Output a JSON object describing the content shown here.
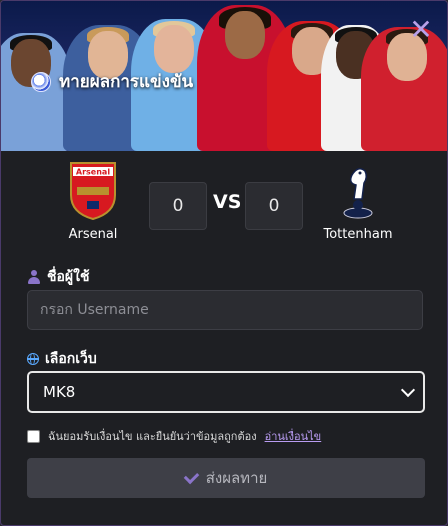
{
  "modal": {
    "title": "ทายผลการแข่งขัน",
    "close_glyph": "✕"
  },
  "match": {
    "home": {
      "name": "Arsenal",
      "score": "0",
      "logo_text": "Arsenal"
    },
    "vs_label": "VS",
    "away": {
      "name": "Tottenham",
      "score": "0"
    }
  },
  "form": {
    "username_label": "ชื่อผู้ใช้",
    "username_placeholder": "กรอก Username",
    "web_label": "เลือกเว็บ",
    "web_selected": "MK8",
    "agree_text": "ฉันยอมรับเงื่อนไข และยืนยันว่าข้อมูลถูกต้อง",
    "agree_link": "อ่านเงื่อนไข",
    "submit_label": "ส่งผลทาย"
  },
  "colors": {
    "accent": "#8a74c9",
    "link": "#b99cf2",
    "background": "#1e1f23"
  }
}
